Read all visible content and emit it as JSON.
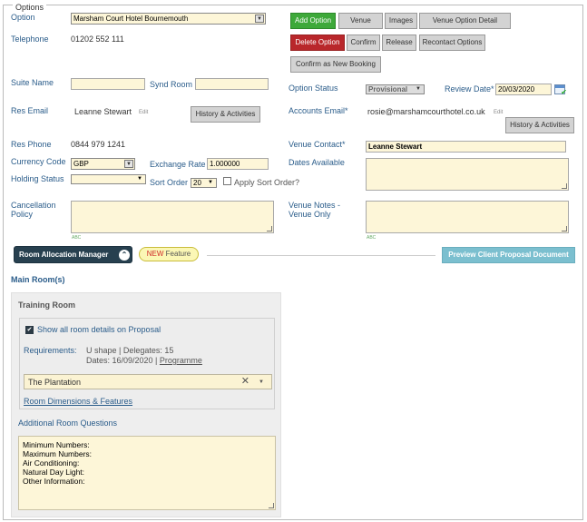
{
  "legend": "Options",
  "option": {
    "label": "Option",
    "value": "Marsham Court Hotel Bournemouth"
  },
  "telephone": {
    "label": "Telephone",
    "value": "01202 552 111"
  },
  "buttons": {
    "add_option": "Add Option",
    "venue": "Venue",
    "images": "Images",
    "venue_option_detail": "Venue Option Detail",
    "delete_option": "Delete Option",
    "confirm": "Confirm",
    "release": "Release",
    "recontact_options": "Recontact Options",
    "confirm_new_booking": "Confirm as New Booking",
    "history_activities_left": "History & Activities",
    "history_activities_right": "History & Activities",
    "room_allocation_manager": "Room Allocation Manager",
    "preview_client_proposal": "Preview Client Proposal Document"
  },
  "suite_name": {
    "label": "Suite Name",
    "value": ""
  },
  "synd_room": {
    "label": "Synd Room",
    "value": ""
  },
  "option_status": {
    "label": "Option Status",
    "value": "Provisional"
  },
  "review_date": {
    "label": "Review Date*",
    "value": "20/03/2020"
  },
  "res_email": {
    "label": "Res Email",
    "value": "Leanne Stewart",
    "edit": "Edit"
  },
  "accounts_email": {
    "label": "Accounts Email*",
    "value": "rosie@marshamcourthotel.co.uk",
    "edit": "Edit"
  },
  "res_phone": {
    "label": "Res Phone",
    "value": "0844 979 1241"
  },
  "venue_contact": {
    "label": "Venue Contact*",
    "value": "Leanne Stewart"
  },
  "currency_code": {
    "label": "Currency Code",
    "value": "GBP"
  },
  "exchange_rate": {
    "label": "Exchange Rate",
    "value": "1.000000"
  },
  "dates_available": {
    "label": "Dates Available"
  },
  "holding_status": {
    "label": "Holding Status",
    "value": ""
  },
  "sort_order": {
    "label": "Sort Order",
    "value": "20"
  },
  "apply_sort_order": {
    "label": "Apply Sort Order?"
  },
  "cancellation_policy": {
    "label_line1": "Cancellation",
    "label_line2": "Policy"
  },
  "venue_notes": {
    "label_line1": "Venue Notes -",
    "label_line2": "Venue Only"
  },
  "spell_mark": "ABC",
  "new_feature": {
    "new": "NEW",
    "text": " Feature"
  },
  "main_rooms": {
    "title": "Main Room(s)",
    "room_title": "Training Room",
    "show_details": "Show all room details on Proposal",
    "requirements_label": "Requirements:",
    "requirements_value": "U shape | Delegates: 15",
    "dates_text": "Dates: 16/09/2020 | ",
    "programme_link": "Programme",
    "room_select": "The Plantation",
    "room_dimensions_link": "Room Dimensions & Features",
    "additional_questions_label": "Additional Room Questions",
    "questions": [
      "Minimum Numbers:",
      "Maximum Numbers:",
      "Air Conditioning:",
      "Natural Day Light:",
      "Other Information:"
    ]
  }
}
